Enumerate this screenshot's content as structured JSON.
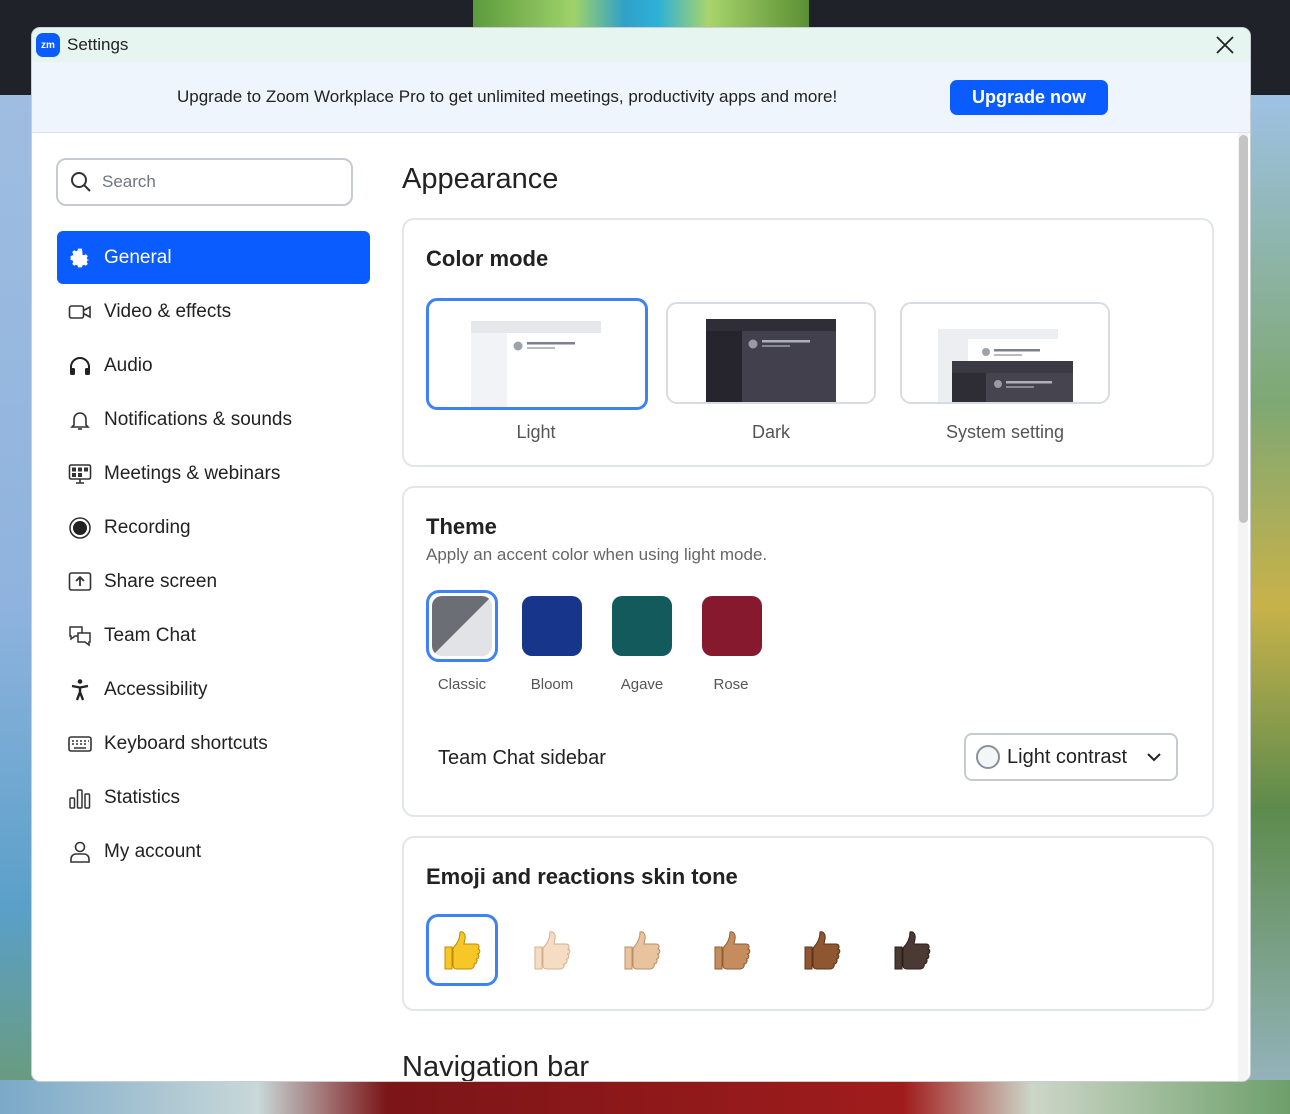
{
  "window": {
    "title": "Settings",
    "logo_text": "zm"
  },
  "banner": {
    "text": "Upgrade to Zoom Workplace Pro to get unlimited meetings, productivity apps and more!",
    "button_label": "Upgrade now"
  },
  "search": {
    "placeholder": "Search"
  },
  "sidebar": {
    "items": [
      {
        "label": "General",
        "icon": "gear-icon",
        "active": true
      },
      {
        "label": "Video & effects",
        "icon": "video-camera-icon"
      },
      {
        "label": "Audio",
        "icon": "headphones-icon"
      },
      {
        "label": "Notifications & sounds",
        "icon": "bell-icon"
      },
      {
        "label": "Meetings & webinars",
        "icon": "meetings-monitor-icon"
      },
      {
        "label": "Recording",
        "icon": "record-icon"
      },
      {
        "label": "Share screen",
        "icon": "share-screen-icon"
      },
      {
        "label": "Team Chat",
        "icon": "chat-bubbles-icon"
      },
      {
        "label": "Accessibility",
        "icon": "accessibility-icon"
      },
      {
        "label": "Keyboard shortcuts",
        "icon": "keyboard-icon"
      },
      {
        "label": "Statistics",
        "icon": "bar-chart-icon"
      },
      {
        "label": "My account",
        "icon": "user-icon"
      }
    ]
  },
  "main": {
    "title": "Appearance",
    "color_mode": {
      "title": "Color mode",
      "options": [
        "Light",
        "Dark",
        "System setting"
      ],
      "selected": "Light"
    },
    "theme": {
      "title": "Theme",
      "subtitle": "Apply an accent color when using light mode.",
      "swatches": [
        {
          "label": "Classic",
          "color": "#6b6e74"
        },
        {
          "label": "Bloom",
          "color": "#17358a"
        },
        {
          "label": "Agave",
          "color": "#125a5b"
        },
        {
          "label": "Rose",
          "color": "#86192e"
        }
      ],
      "selected": "Classic",
      "team_chat_sidebar": {
        "label": "Team Chat sidebar",
        "value": "Light contrast"
      }
    },
    "emoji": {
      "title": "Emoji and reactions skin tone",
      "tones": [
        "#f7c728",
        "#f7dcc4",
        "#e9c39e",
        "#c58c5e",
        "#8e5631",
        "#4a3a33"
      ],
      "selected_index": 0
    },
    "next_section_title": "Navigation bar"
  },
  "colors": {
    "accent": "#0b5cff",
    "selection": "#3d83f5"
  }
}
